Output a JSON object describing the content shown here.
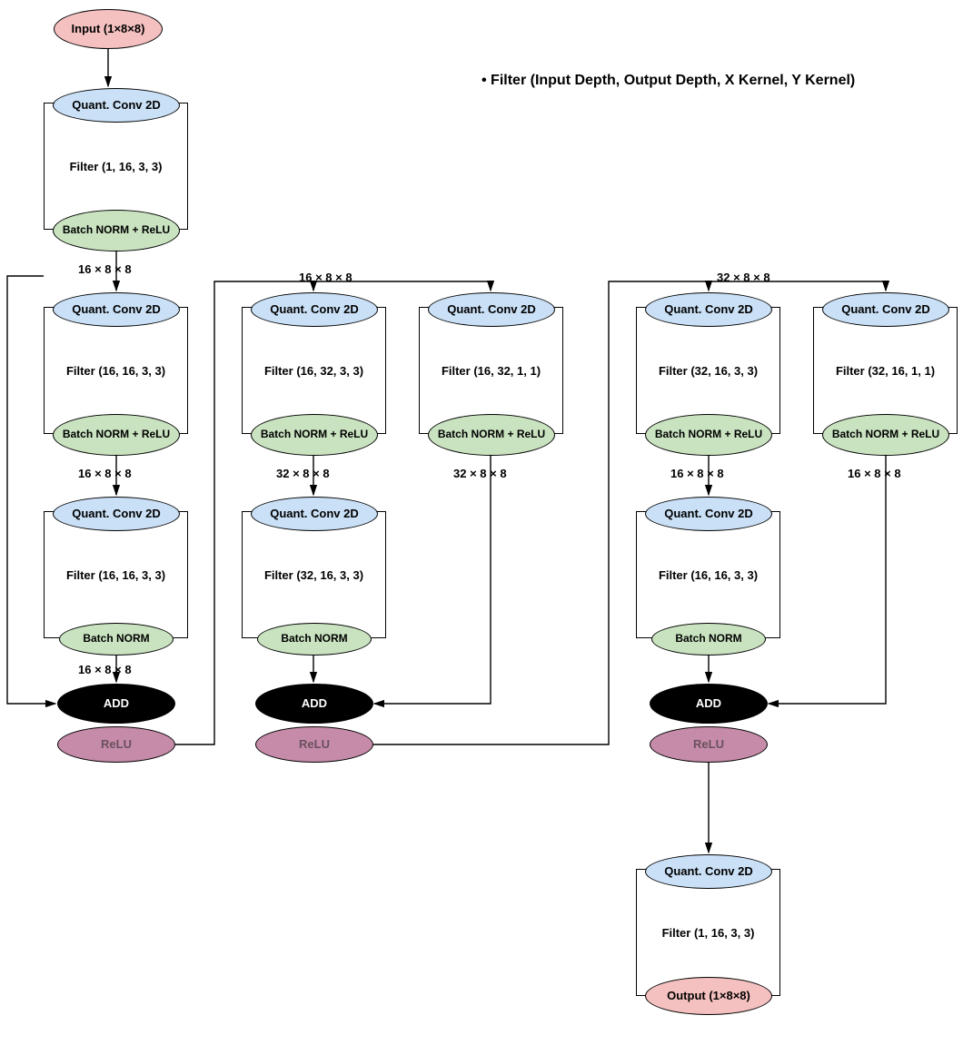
{
  "legend": "Filter (Input Depth, Output Depth, X Kernel, Y Kernel)",
  "labels": {
    "input": "Input (1×8×8)",
    "quant": "Quant. Conv 2D",
    "bnrelu": "Batch NORM + ReLU",
    "bn": "Batch NORM",
    "add": "ADD",
    "relu": "ReLU",
    "output": "Output (1×8×8)"
  },
  "filters": {
    "f0": "Filter (1, 16, 3, 3)",
    "f1a": "Filter (16, 16, 3, 3)",
    "f1b": "Filter (16, 16, 3, 3)",
    "f2a": "Filter (16, 32, 3, 3)",
    "f2s": "Filter (16, 32, 1, 1)",
    "f2b": "Filter (32, 16, 3, 3)",
    "f3a": "Filter (32, 16, 3, 3)",
    "f3s": "Filter (32, 16, 1, 1)",
    "f3b": "Filter (16, 16, 3, 3)",
    "fout": "Filter (1, 16, 3, 3)"
  },
  "dims": {
    "d16": "16 × 8  × 8",
    "d32": "32 × 8  × 8"
  }
}
